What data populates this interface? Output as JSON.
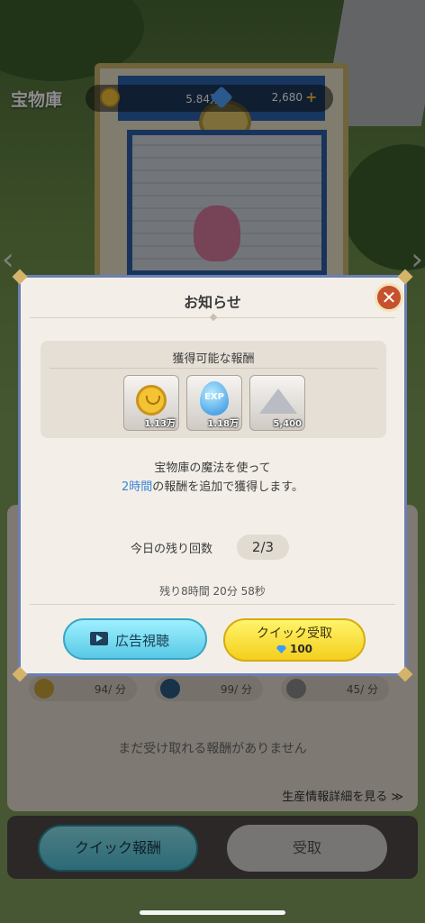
{
  "header": {
    "title": "宝物庫",
    "gold": "5.84万",
    "gems": "2,680",
    "plus_label": "+"
  },
  "modal": {
    "title": "お知らせ",
    "close_label": "✕",
    "reward_section_title": "獲得可能な報酬",
    "rewards": [
      {
        "icon": "coin-icon",
        "value": "1.13万"
      },
      {
        "icon": "exp-icon",
        "value": "1.18万",
        "label": "EXP"
      },
      {
        "icon": "ore-icon",
        "value": "5,400"
      }
    ],
    "message_line1": "宝物庫の魔法を使って",
    "message_highlight": "2時間",
    "message_line2_rest": "の報酬を追加で獲得します。",
    "daily_count_label": "今日の残り回数",
    "daily_count_value": "2/3",
    "remaining_time": "残り8時間 20分 58秒",
    "ad_button_label": "広告視聴",
    "quick_button_label": "クイック受取",
    "quick_button_cost": "100"
  },
  "background": {
    "rates": [
      {
        "icon": "coin-icon",
        "value": "94/ 分"
      },
      {
        "icon": "exp-icon",
        "value": "99/ 分"
      },
      {
        "icon": "ore-icon",
        "value": "45/ 分"
      }
    ],
    "no_rewards_text": "まだ受け取れる報酬がありません",
    "detail_link": "生産情報詳細を見る ≫",
    "quick_reward_button": "クイック報酬",
    "receive_button": "受取"
  },
  "colors": {
    "highlight": "#3d86d9",
    "close_button": "#c5512d",
    "ad_button": "#58c9e6",
    "quick_button": "#f4cf1d"
  }
}
